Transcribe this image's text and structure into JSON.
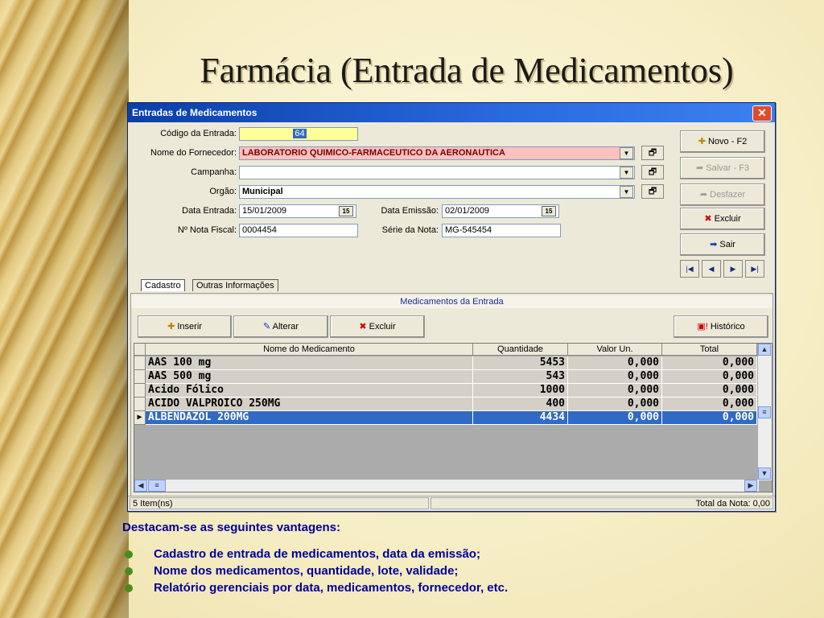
{
  "slide": {
    "title": "Farmácia (Entrada de Medicamentos)",
    "intro": "Destacam-se as seguintes vantagens:",
    "bullets": [
      "Cadastro de entrada de medicamentos, data da emissão;",
      "Nome dos medicamentos, quantidade, lote, validade;",
      "Relatório gerenciais por data, medicamentos, fornecedor, etc."
    ]
  },
  "window": {
    "title": "Entradas de Medicamentos",
    "close_glyph": "✕"
  },
  "form": {
    "codigo_label": "Código da Entrada:",
    "codigo_value": "64",
    "fornecedor_label": "Nome do Fornecedor:",
    "fornecedor_value": "LABORATORIO QUIMICO-FARMACEUTICO DA AERONAUTICA",
    "campanha_label": "Campanha:",
    "campanha_value": "",
    "orgao_label": "Orgão:",
    "orgao_value": "Municipal",
    "data_entrada_label": "Data Entrada:",
    "data_entrada_value": "15/01/2009",
    "data_emissao_label": "Data Emissão:",
    "data_emissao_value": "02/01/2009",
    "nota_fiscal_label": "Nº Nota Fiscal:",
    "nota_fiscal_value": "0004454",
    "serie_label": "Série da Nota:",
    "serie_value": "MG-545454",
    "calendar_glyph": "15",
    "combo_glyph": "▼",
    "lookup_glyph": "🗗"
  },
  "side_buttons": {
    "novo": "Novo - F2",
    "salvar": "Salvar - F3",
    "desfazer": "Desfazer",
    "excluir": "Excluir",
    "sair": "Sair"
  },
  "nav": {
    "first": "|◀",
    "prev": "◀",
    "next": "▶",
    "last": "▶|"
  },
  "tabs": [
    "Cadastro",
    "Outras Informações"
  ],
  "panel": {
    "header": "Medicamentos da Entrada",
    "inserir": "Inserir",
    "alterar": "Alterar",
    "excluir": "Excluir",
    "historico": "Histórico"
  },
  "grid": {
    "columns": [
      "Nome do Medicamento",
      "Quantidade",
      "Valor Un.",
      "Total"
    ],
    "rows": [
      {
        "nome": "AAS 100 mg",
        "quantidade": "5453",
        "valor": "0,000",
        "total": "0,000"
      },
      {
        "nome": "AAS 500 mg",
        "quantidade": "543",
        "valor": "0,000",
        "total": "0,000"
      },
      {
        "nome": "Ácido Fólico",
        "quantidade": "1000",
        "valor": "0,000",
        "total": "0,000"
      },
      {
        "nome": "ACIDO VALPROICO 250MG",
        "quantidade": "400",
        "valor": "0,000",
        "total": "0,000"
      },
      {
        "nome": "ALBENDAZOL 200MG",
        "quantidade": "4434",
        "valor": "0,000",
        "total": "0,000",
        "selected": true
      }
    ],
    "row_indicator": "▶"
  },
  "status": {
    "items": "5 Item(ns)",
    "total_nota": "Total da Nota: 0,00"
  }
}
